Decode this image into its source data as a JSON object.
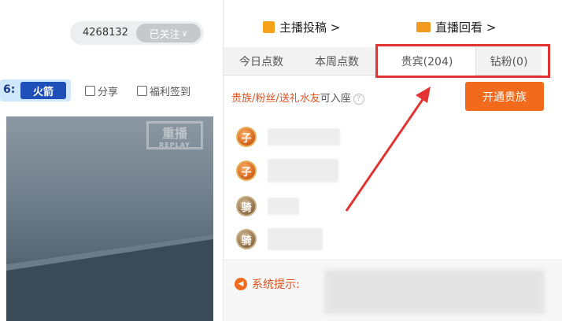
{
  "header": {
    "follower_count": "4268132",
    "follow_button": "已关注",
    "follow_chevron": "∨"
  },
  "toolbar": {
    "tag_prefix": "6:",
    "tag_name": "火箭",
    "share_label": "分享",
    "checkin_label": "福利签到"
  },
  "video": {
    "watermark_top": "重播",
    "watermark_bottom": "REPLAY"
  },
  "top_links": {
    "submissions": "主播投稿 >",
    "replay": "直播回看 >"
  },
  "tabs": [
    {
      "label": "今日点数",
      "active": false
    },
    {
      "label": "本周点数",
      "active": false
    },
    {
      "label": "贵宾(204)",
      "active": true
    },
    {
      "label": "钻粉(0)",
      "active": false
    }
  ],
  "notice": {
    "red_text": "贵族/粉丝/送礼水友",
    "grey_text": "可入座",
    "help": "?"
  },
  "open_button": "开通贵族",
  "users": [
    {
      "medal": "子",
      "medal_type": "zi"
    },
    {
      "medal": "子",
      "medal_type": "zi"
    },
    {
      "medal": "骑",
      "medal_type": "qi"
    },
    {
      "medal": "骑",
      "medal_type": "qi"
    }
  ],
  "system": {
    "label": "系统提示:",
    "speaker_icon": "speaker-icon"
  },
  "colors": {
    "accent_orange": "#f26a1b",
    "highlight_red": "#e23232",
    "follow_grey": "#c6c9cc"
  }
}
